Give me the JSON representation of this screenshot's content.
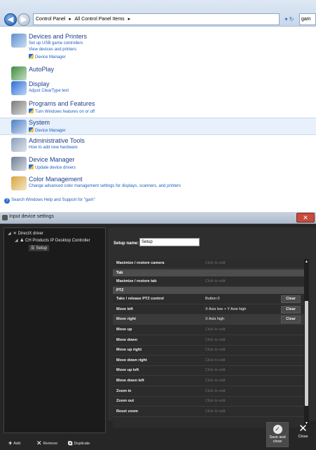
{
  "address": {
    "crumbs": [
      "Control Panel",
      "▸",
      "All Control Panel Items",
      "▸"
    ],
    "search": "gam"
  },
  "items": [
    {
      "title": "Devices and Printers",
      "subs": [
        "Set up USB game controllers",
        "View devices and printers",
        "Device Manager"
      ]
    },
    {
      "title": "AutoPlay",
      "subs": []
    },
    {
      "title": "Display",
      "subs": [
        "Adjust ClearType text"
      ]
    },
    {
      "title": "Programs and Features",
      "subs": [
        "Turn Windows features on or off"
      ]
    },
    {
      "title": "System",
      "subs": [
        "Device Manager"
      ]
    },
    {
      "title": "Administrative Tools",
      "subs": [
        "How to add new hardware"
      ]
    },
    {
      "title": "Device Manager",
      "subs": [
        "Update device drivers"
      ]
    },
    {
      "title": "Color Management",
      "subs": [
        "Change advanced color management settings for displays, scanners, and printers"
      ]
    }
  ],
  "search_help": "Search Windows Help and Support for \"gam\"",
  "window": {
    "title": "Input device settings",
    "close_glyph": "✕",
    "tree": {
      "root": "DirectX driver",
      "device": "CH Products IP Desktop Controller",
      "setup": "Setup"
    },
    "setup_name_label": "Setup name:",
    "setup_name_value": "Setup",
    "rows": [
      {
        "kind": "row",
        "label": "Maximize / restore camera",
        "value": "Click to edit",
        "set": false,
        "clear": false
      },
      {
        "kind": "header",
        "label": "Tab"
      },
      {
        "kind": "row",
        "label": "Maximize / restore tab",
        "value": "Click to edit",
        "set": false,
        "clear": false
      },
      {
        "kind": "header",
        "label": "PTZ"
      },
      {
        "kind": "row",
        "label": "Take / release PTZ control",
        "value": "Button 0",
        "set": true,
        "clear": true
      },
      {
        "kind": "row",
        "label": "Move left",
        "value": "X Axis low + Y Axis high",
        "set": true,
        "clear": true
      },
      {
        "kind": "row",
        "label": "Move right",
        "value": "X Axis high",
        "set": true,
        "clear": true
      },
      {
        "kind": "row",
        "label": "Move up",
        "value": "Click to edit",
        "set": false,
        "clear": false
      },
      {
        "kind": "row",
        "label": "Move down",
        "value": "Click to edit",
        "set": false,
        "clear": false
      },
      {
        "kind": "row",
        "label": "Move up right",
        "value": "Click to edit",
        "set": false,
        "clear": false
      },
      {
        "kind": "row",
        "label": "Move down right",
        "value": "Click to edit",
        "set": false,
        "clear": false
      },
      {
        "kind": "row",
        "label": "Move up left",
        "value": "Click to edit",
        "set": false,
        "clear": false
      },
      {
        "kind": "row",
        "label": "Move down left",
        "value": "Click to edit",
        "set": false,
        "clear": false
      },
      {
        "kind": "row",
        "label": "Zoom in",
        "value": "Click to edit",
        "set": false,
        "clear": false
      },
      {
        "kind": "row",
        "label": "Zoom out",
        "value": "Click to edit",
        "set": false,
        "clear": false
      },
      {
        "kind": "row",
        "label": "Reset zoom",
        "value": "Click to edit",
        "set": false,
        "clear": false
      }
    ],
    "clear_label": "Clear",
    "buttons": {
      "add": "Add",
      "remove": "Remove",
      "duplicate": "Duplicate",
      "save_close": [
        "Save and",
        "close"
      ],
      "close": "Close"
    }
  },
  "colors": {
    "link_title": "#1e3f8a",
    "link_sub": "#1c5fc2",
    "dark_bg": "#262626"
  }
}
